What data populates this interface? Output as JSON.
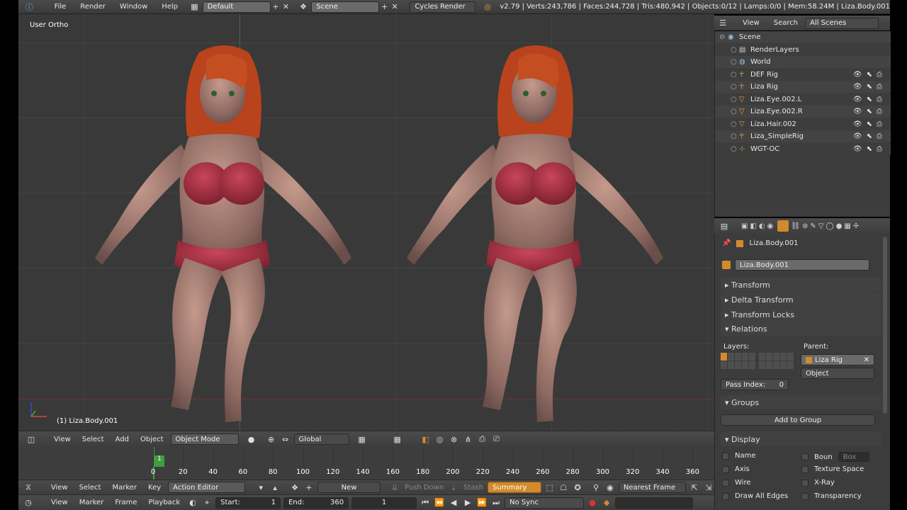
{
  "colors": {
    "accent_orange": "#d28a2c",
    "header_bg": "#474747",
    "viewport_bg": "#393939"
  },
  "info_header": {
    "menus": [
      "File",
      "Render",
      "Window",
      "Help"
    ],
    "layout_name": "Default",
    "scene_name": "Scene",
    "render_engine": "Cycles Render",
    "stats": "v2.79 | Verts:243,786 | Faces:244,728 | Tris:480,942 | Objects:0/12 | Lamps:0/0 | Mem:58.24M | Liza.Body.001"
  },
  "viewport": {
    "view_label": "User Ortho",
    "object_label": "(1) Liza.Body.001",
    "menus": [
      "View",
      "Select",
      "Add",
      "Object"
    ],
    "mode": "Object Mode",
    "orientation": "Global"
  },
  "timeline": {
    "current_frame": "1",
    "ticks": [
      "0",
      "20",
      "40",
      "60",
      "80",
      "100",
      "120",
      "140",
      "160",
      "180",
      "200",
      "220",
      "240",
      "260",
      "280",
      "300",
      "320",
      "340",
      "360"
    ]
  },
  "action_editor": {
    "menus": [
      "View",
      "Select",
      "Marker",
      "Key"
    ],
    "mode": "Action Editor",
    "new_label": "New",
    "push_down": "Push Down",
    "stash": "Stash",
    "summary": "Summary",
    "snap": "Nearest Frame"
  },
  "timeline_header": {
    "menus": [
      "View",
      "Marker",
      "Frame",
      "Playback"
    ],
    "start_label": "Start:",
    "start_value": "1",
    "end_label": "End:",
    "end_value": "360",
    "current": "1",
    "sync": "No Sync"
  },
  "outliner": {
    "menus": [
      "View",
      "Search"
    ],
    "filter": "All Scenes",
    "items": [
      {
        "label": "Scene",
        "icon": "scene-icon"
      },
      {
        "label": "RenderLayers",
        "icon": "renderlayers-icon"
      },
      {
        "label": "World",
        "icon": "world-icon"
      },
      {
        "label": "DEF Rig",
        "icon": "armature-icon"
      },
      {
        "label": "Liza Rig",
        "icon": "armature-icon"
      },
      {
        "label": "Liza.Eye.002.L",
        "icon": "mesh-icon"
      },
      {
        "label": "Liza.Eye.002.R",
        "icon": "mesh-icon"
      },
      {
        "label": "Liza.Hair.002",
        "icon": "mesh-icon"
      },
      {
        "label": "Liza_SimpleRig",
        "icon": "armature-icon"
      },
      {
        "label": "WGT-OC",
        "icon": "empty-icon"
      }
    ]
  },
  "properties": {
    "breadcrumb": "Liza.Body.001",
    "object_name": "Liza.Body.001",
    "panels": {
      "transform": "Transform",
      "delta_transform": "Delta Transform",
      "transform_locks": "Transform Locks",
      "relations": "Relations",
      "groups": "Groups",
      "display": "Display"
    },
    "layers_label": "Layers:",
    "parent_label": "Parent:",
    "parent_value": "Liza Rig",
    "parent_type": "Object",
    "pass_index_label": "Pass Index:",
    "pass_index_value": "0",
    "add_to_group": "Add to Group",
    "display_options": {
      "name": "Name",
      "bounds": "Boun",
      "bounds_type": "Box",
      "axis": "Axis",
      "texture_space": "Texture Space",
      "wire": "Wire",
      "xray": "X-Ray",
      "draw_all_edges": "Draw All Edges",
      "transparency": "Transparency"
    }
  }
}
